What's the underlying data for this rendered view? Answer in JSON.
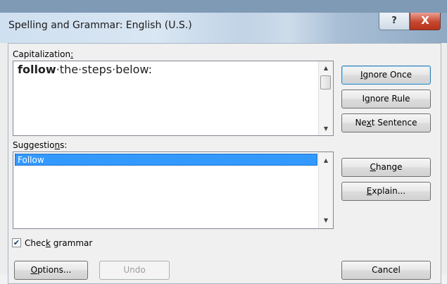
{
  "window": {
    "title": "Spelling and Grammar: English (U.S.)"
  },
  "titlebar": {
    "help_glyph": "?",
    "close_glyph": "X"
  },
  "capitalization": {
    "label_pre": "Capitalization",
    "label_accel": ":",
    "error_word": "follow",
    "rest_text": "·the·steps·below:"
  },
  "suggestions": {
    "label_pre": "Suggestio",
    "label_accel": "n",
    "label_post": "s:",
    "items": [
      "Follow"
    ]
  },
  "buttons": {
    "ignore_once": {
      "pre": "",
      "accel": "I",
      "post": "gnore Once"
    },
    "ignore_rule": {
      "pre": "I",
      "accel": "g",
      "post": "nore Rule"
    },
    "next_sentence": {
      "pre": "Ne",
      "accel": "x",
      "post": "t Sentence"
    },
    "change": {
      "pre": "",
      "accel": "C",
      "post": "hange"
    },
    "explain": {
      "pre": "",
      "accel": "E",
      "post": "xplain..."
    },
    "options": {
      "pre": "",
      "accel": "O",
      "post": "ptions..."
    },
    "undo": "Undo",
    "cancel": "Cancel"
  },
  "check_grammar": {
    "pre": "Chec",
    "accel": "k",
    "post": " grammar",
    "checked": true,
    "check_glyph": "✔"
  },
  "icons": {
    "scroll_up": "▲",
    "scroll_down": "▼"
  },
  "colors": {
    "selection": "#3399ff",
    "title_bar": "#cfe0f0",
    "close": "#c7472f"
  }
}
